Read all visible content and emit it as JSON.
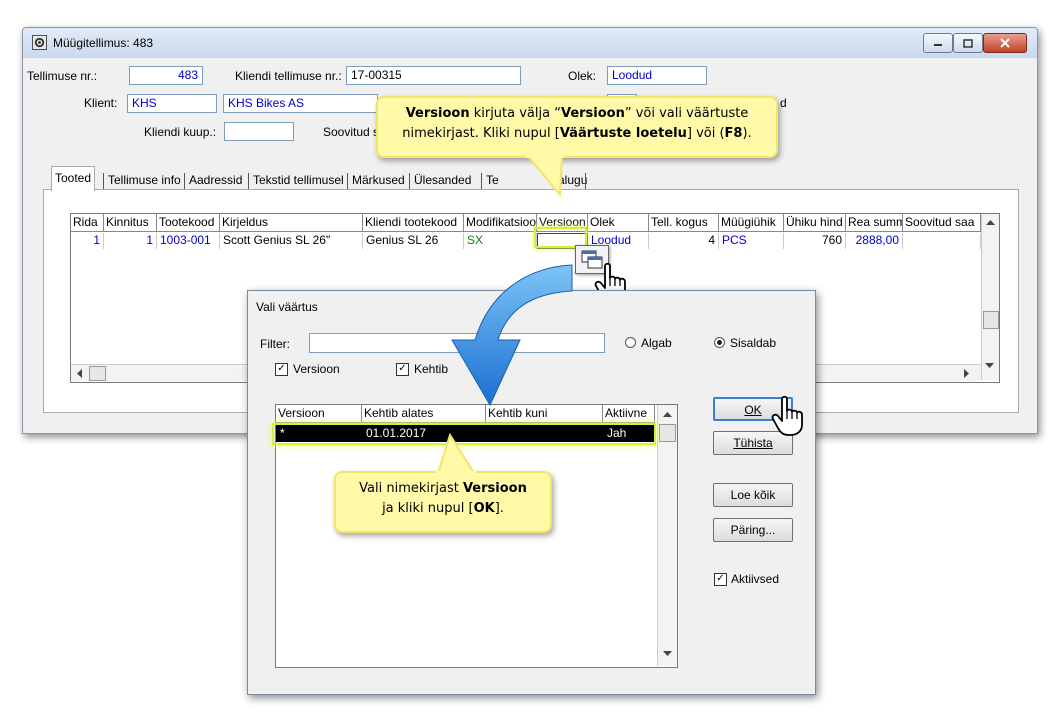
{
  "window": {
    "title": "Müügitellimus: 483"
  },
  "header": {
    "order_no_label": "Tellimuse nr.:",
    "order_no_value": "483",
    "client_order_label": "Kliendi tellimuse nr.:",
    "client_order_value": "17-00315",
    "status_label": "Olek:",
    "status_value": "Loodud",
    "client_label": "Klient:",
    "client_code": "KHS",
    "client_name": "KHS Bikes AS",
    "client_date_label": "Kliendi kuup.:",
    "client_date_value": "",
    "agreed_label": "Soovitud s",
    "right_tail": "d"
  },
  "tabs": [
    "Tooted",
    "Tellimuse info",
    "Aadressid",
    "Tekstid tellimusel",
    "Märkused",
    "Ülesanded",
    "Te",
    "alugu"
  ],
  "grid": {
    "columns": [
      "Rida",
      "Kinnitus",
      "Tootekood",
      "Kirjeldus",
      "Kliendi tootekood",
      "Modifikatsioo",
      "Versioon",
      "Olek",
      "Tell. kogus",
      "Müügiühik",
      "Ühiku hind",
      "Rea summ",
      "Soovitud saa"
    ],
    "row": {
      "rida": "1",
      "kinnitus": "1",
      "tootekood": "1003-001",
      "kirjeldus": "Scott Genius SL 26\"",
      "kliendi_tootekood": "Genius SL 26",
      "modifikatsioon": "SX",
      "versioon": "",
      "olek": "Loodud",
      "kogus": "4",
      "yhik": "PCS",
      "hind": "760",
      "summa": "2888,00",
      "soovitud": ""
    }
  },
  "callout_top": {
    "part1": "Versioon",
    "part2": " kirjuta välja “",
    "part3": "Versioon",
    "part4": "” või vali väärtuste nimekirjast. Kliki nupul [",
    "part5": "Väärtuste loetelu",
    "part6": "] või (",
    "part7": "F8",
    "part8": ")."
  },
  "dialog": {
    "title": "Vali väärtus",
    "filter_label": "Filter:",
    "filter_value": "",
    "radio_starts": "Algab",
    "radio_contains": "Sisaldab",
    "check_version": "Versioon",
    "check_valid": "Kehtib",
    "columns": [
      "Versioon",
      "Kehtib alates",
      "Kehtib kuni",
      "Aktiivne"
    ],
    "row": {
      "versioon": "*",
      "alates": "01.01.2017",
      "kuni": "",
      "aktiivne": "Jah"
    },
    "ok_label": "OK",
    "cancel_label": "Tühista",
    "load_all_label": "Loe kõik",
    "query_label": "Päring...",
    "active_label": "Aktiivsed"
  },
  "callout_bottom": {
    "line1a": "Vali nimekirjast ",
    "line1b": "Versioon",
    "line2a": "ja kliki nupul [",
    "line2b": "OK",
    "line2c": "]."
  },
  "colors": {
    "callout_bg": "#fff9a8",
    "highlight": "#d4f03a",
    "arrow": "#2f8fe0",
    "link_blue": "#0000cc"
  }
}
